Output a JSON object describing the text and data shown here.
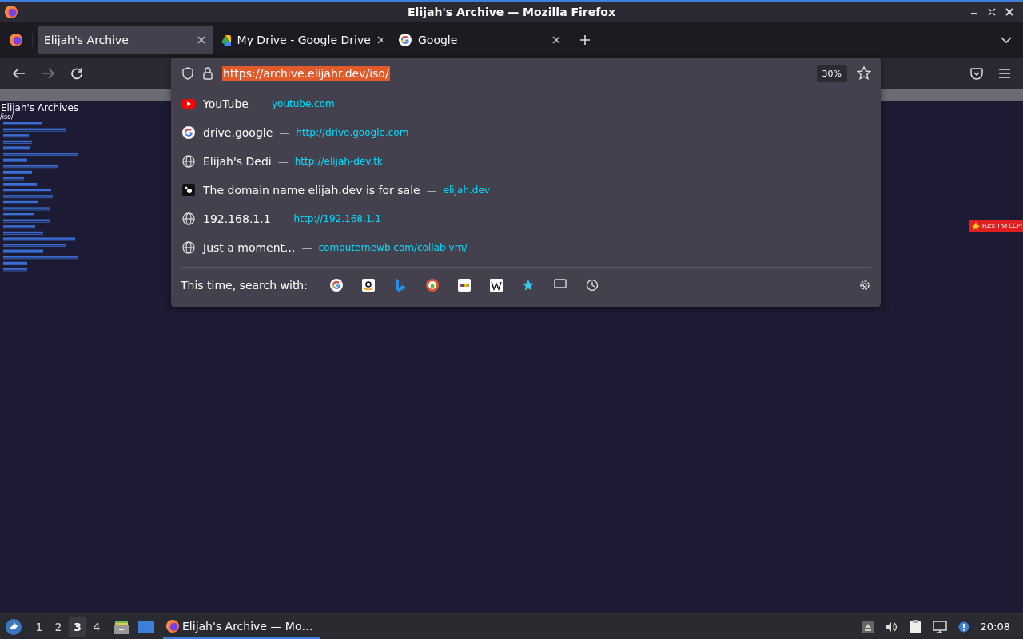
{
  "window": {
    "title": "Elijah's Archive — Mozilla Firefox"
  },
  "tabs": [
    {
      "label": "Elijah's Archive",
      "kind": "page",
      "selected": true
    },
    {
      "label": "My Drive - Google Drive",
      "kind": "drive",
      "selected": false
    },
    {
      "label": "Google",
      "kind": "google",
      "selected": false
    }
  ],
  "url_bar": {
    "value": "https://archive.elijahr.dev/iso/",
    "zoom": "30%"
  },
  "suggestions": [
    {
      "kind": "youtube",
      "title": "YouTube",
      "separator": "—",
      "url": "youtube.com"
    },
    {
      "kind": "google",
      "title": "drive.google",
      "separator": "—",
      "url": "http://drive.google.com"
    },
    {
      "kind": "globe",
      "title": "Elijah's Dedi",
      "separator": "—",
      "url": "http://elijah-dev.tk"
    },
    {
      "kind": "dark",
      "title": "The domain name elijah.dev is for sale",
      "separator": "—",
      "url": "elijah.dev"
    },
    {
      "kind": "globe",
      "title": "192.168.1.1",
      "separator": "—",
      "url": "http://192.168.1.1"
    },
    {
      "kind": "globe",
      "title": "Just a moment...",
      "separator": "—",
      "url": "computernewb.com/collab-vm/"
    }
  ],
  "search_with": {
    "label": "This time, search with:",
    "engines": [
      {
        "kind": "google"
      },
      {
        "kind": "amazon"
      },
      {
        "kind": "bing"
      },
      {
        "kind": "duckduckgo"
      },
      {
        "kind": "ebay"
      },
      {
        "kind": "wikipedia"
      },
      {
        "kind": "bookmarks"
      },
      {
        "kind": "tabs"
      },
      {
        "kind": "history"
      }
    ]
  },
  "page": {
    "heading": "Elijah's Archives",
    "path": "/iso/",
    "banner": "Fuck The CCP!"
  },
  "taskbar": {
    "workspaces": [
      {
        "label": "1",
        "selected": false
      },
      {
        "label": "2",
        "selected": false
      },
      {
        "label": "3",
        "selected": true
      },
      {
        "label": "4",
        "selected": false
      }
    ],
    "task": "Elijah's Archive — Mo…",
    "clock": "20:08"
  }
}
